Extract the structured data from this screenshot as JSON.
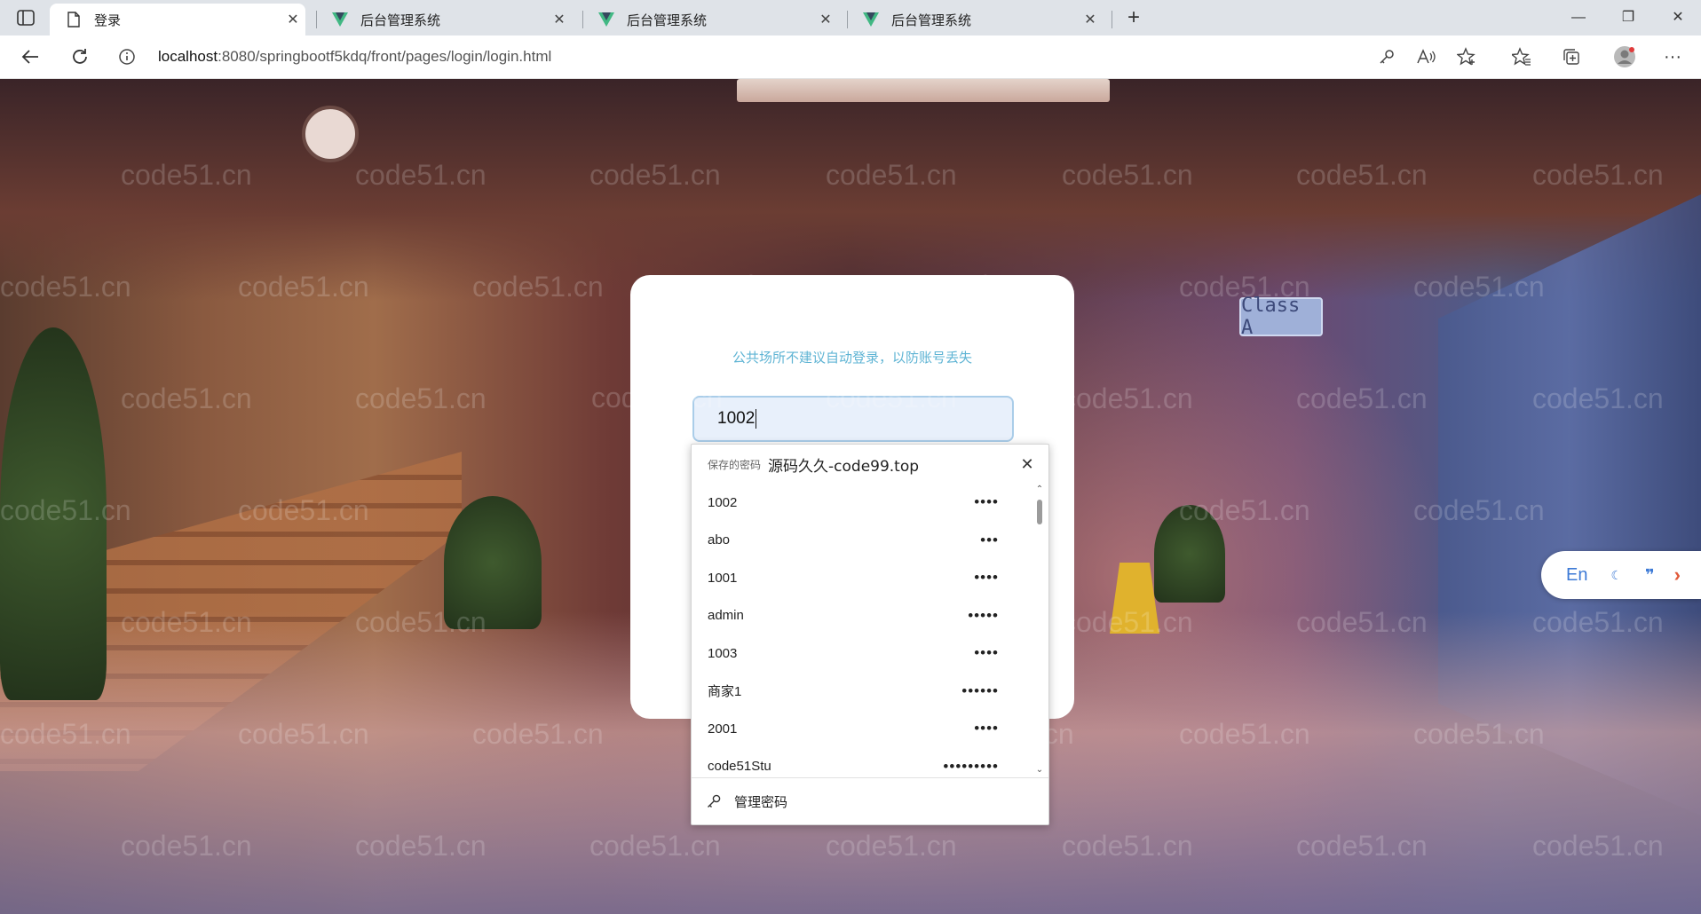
{
  "tabs": [
    {
      "title": "登录",
      "favicon": "page-icon",
      "active": true
    },
    {
      "title": "后台管理系统",
      "favicon": "vue-logo-icon",
      "active": false
    },
    {
      "title": "后台管理系统",
      "favicon": "vue-logo-icon",
      "active": false
    },
    {
      "title": "后台管理系统",
      "favicon": "vue-logo-icon",
      "active": false
    }
  ],
  "address": {
    "host": "localhost",
    "path": ":8080/springbootf5kdq/front/pages/login/login.html"
  },
  "watermark": "code51.cn",
  "background": {
    "sign_text": "Class A"
  },
  "login": {
    "tip": "公共场所不建议自动登录，以防账号丢失",
    "username_value": "1002"
  },
  "autofill": {
    "header_label": "保存的密码",
    "header_site": "源码久久-code99.top",
    "items": [
      {
        "username": "1002",
        "password_mask": "••••"
      },
      {
        "username": "abo",
        "password_mask": "•••"
      },
      {
        "username": "1001",
        "password_mask": "••••"
      },
      {
        "username": "admin",
        "password_mask": "•••••"
      },
      {
        "username": "1003",
        "password_mask": "••••"
      },
      {
        "username": "商家1",
        "password_mask": "••••••"
      },
      {
        "username": "2001",
        "password_mask": "••••"
      },
      {
        "username": "code51Stu",
        "password_mask": "•••••••••"
      }
    ],
    "footer_label": "管理密码"
  },
  "translate_widget": {
    "label": "En"
  },
  "colors": {
    "tip_text": "#5fb4d4",
    "input_bg": "#e8f0fb",
    "translate_accent": "#3d7ad6"
  }
}
